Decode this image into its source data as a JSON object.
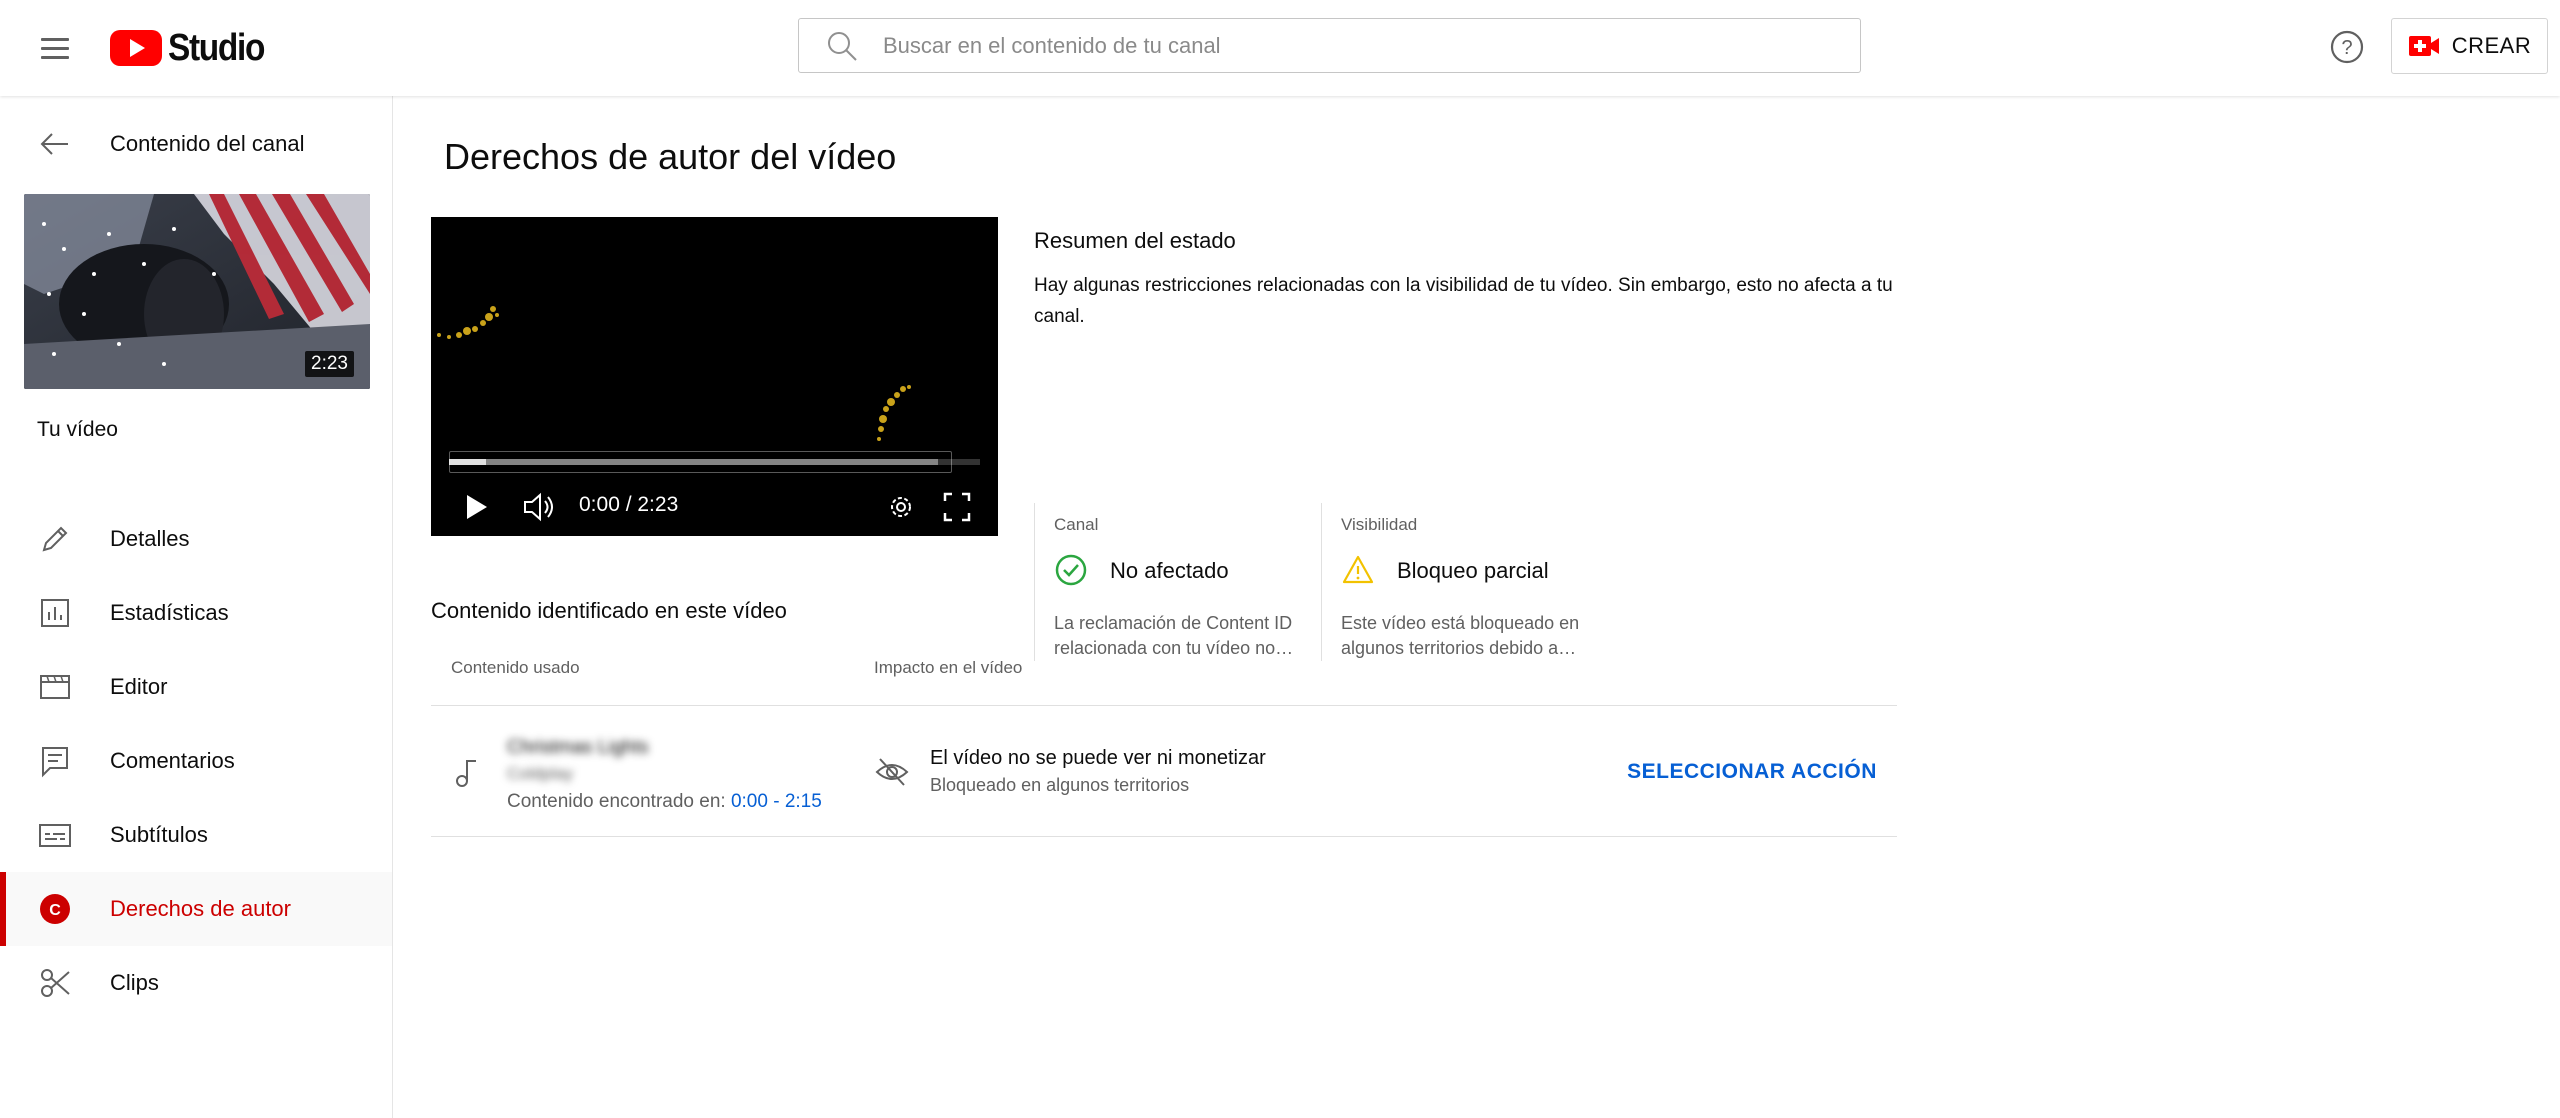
{
  "header": {
    "logo_text": "Studio",
    "search_placeholder": "Buscar en el contenido de tu canal",
    "create_label": "CREAR"
  },
  "sidebar": {
    "back_label": "Contenido del canal",
    "thumbnail_duration": "2:23",
    "your_video_label": "Tu vídeo",
    "items": [
      {
        "label": "Detalles",
        "icon": "pencil-icon"
      },
      {
        "label": "Estadísticas",
        "icon": "analytics-icon"
      },
      {
        "label": "Editor",
        "icon": "clapperboard-icon"
      },
      {
        "label": "Comentarios",
        "icon": "comment-icon"
      },
      {
        "label": "Subtítulos",
        "icon": "subtitles-icon"
      },
      {
        "label": "Derechos de autor",
        "icon": "copyright-icon",
        "badge": "C",
        "active": true
      },
      {
        "label": "Clips",
        "icon": "scissors-icon"
      }
    ]
  },
  "main": {
    "title": "Derechos de autor del vídeo",
    "player": {
      "time": "0:00 / 2:23",
      "played_fraction": 0.07,
      "buffered_fraction": 0.92
    },
    "summary": {
      "title": "Resumen del estado",
      "description": "Hay algunas restricciones relacionadas con la visibilidad de tu vídeo. Sin embargo, esto no afecta a tu canal.",
      "channel": {
        "label": "Canal",
        "value": "No afectado",
        "note_line1": "La reclamación de Content ID",
        "note_line2": "relacionada con tu vídeo no…",
        "color": "#2ba640"
      },
      "visibility": {
        "label": "Visibilidad",
        "value": "Bloqueo parcial",
        "note_line1": "Este vídeo está bloqueado en",
        "note_line2": "algunos territorios debido a…",
        "color": "#f2c200"
      }
    },
    "identified": {
      "title": "Contenido identificado en este vídeo",
      "columns": [
        "Contenido usado",
        "Impacto en el vídeo"
      ],
      "rows": [
        {
          "song_title": "Christmas Lights",
          "artist": "Coldplay",
          "found_label": "Contenido encontrado en: ",
          "found_range": "0:00 - 2:15",
          "impact_main": "El vídeo no se puede ver ni monetizar",
          "impact_sub": "Bloqueado en algunos territorios",
          "action_label": "SELECCIONAR ACCIÓN"
        }
      ]
    }
  },
  "colors": {
    "brand_red": "#ff0000",
    "active_red": "#cc0000",
    "link_blue": "#065fd4"
  }
}
